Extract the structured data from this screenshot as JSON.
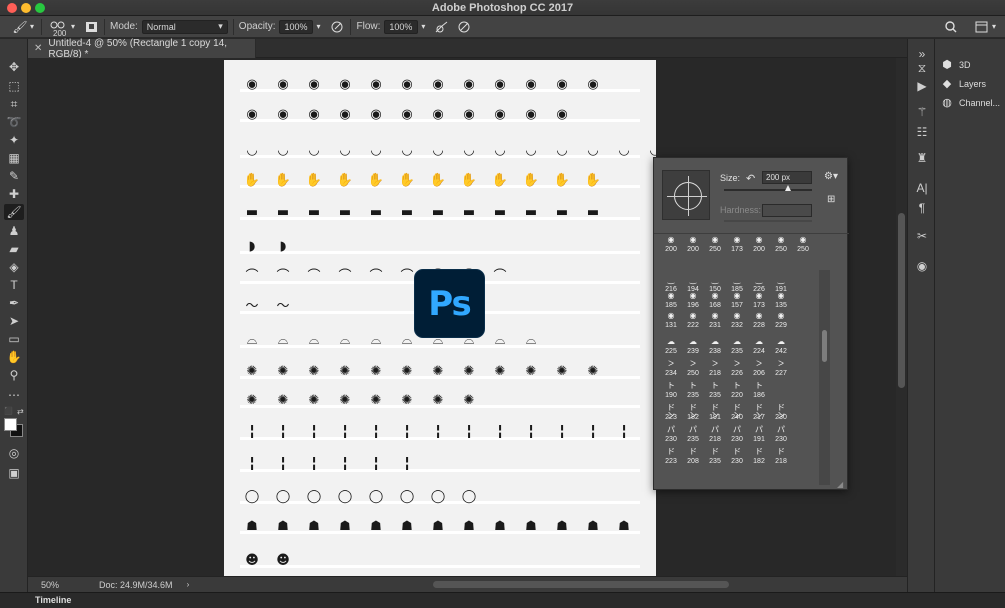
{
  "app": {
    "title": "Adobe Photoshop CC 2017"
  },
  "colors": {
    "accent": "#31a8ff",
    "ps_logo_bg": "#001e36"
  },
  "options_bar": {
    "brush_size": "200",
    "mode_label": "Mode:",
    "mode_value": "Normal",
    "opacity_label": "Opacity:",
    "opacity_value": "100%",
    "flow_label": "Flow:",
    "flow_value": "100%"
  },
  "tab": {
    "close": "✕",
    "title": "Untitled-4 @ 50% (Rectangle 1 copy 14, RGB/8) *"
  },
  "logo": {
    "text": "Ps"
  },
  "brush_panel": {
    "size_label": "Size:",
    "size_value": "200 px",
    "hardness_label": "Hardness:",
    "rows": [
      [
        "200",
        "200",
        "250",
        "173",
        "200",
        "250",
        "250"
      ],
      [
        "216",
        "194",
        "150",
        "185",
        "226",
        "191"
      ],
      [
        "185",
        "196",
        "168",
        "157",
        "173",
        "135"
      ],
      [
        "131",
        "222",
        "231",
        "232",
        "228",
        "229"
      ],
      [
        "225",
        "239",
        "238",
        "235",
        "224",
        "242"
      ],
      [
        "234",
        "250",
        "218",
        "226",
        "206",
        "227"
      ],
      [
        "190",
        "235",
        "235",
        "220",
        "186"
      ],
      [
        "223",
        "182",
        "191",
        "240",
        "217",
        "230"
      ],
      [
        "230",
        "235",
        "218",
        "230",
        "191",
        "230"
      ],
      [
        "223",
        "208",
        "235",
        "230",
        "182",
        "218"
      ]
    ]
  },
  "right_panel": {
    "items": [
      {
        "label": "3D",
        "icon": "cube-icon"
      },
      {
        "label": "Layers",
        "icon": "layers-icon"
      },
      {
        "label": "Channel...",
        "icon": "channels-icon"
      }
    ]
  },
  "status": {
    "zoom": "50%",
    "doc": "Doc: 24.9M/34.6M"
  },
  "timeline": {
    "label": "Timeline"
  }
}
